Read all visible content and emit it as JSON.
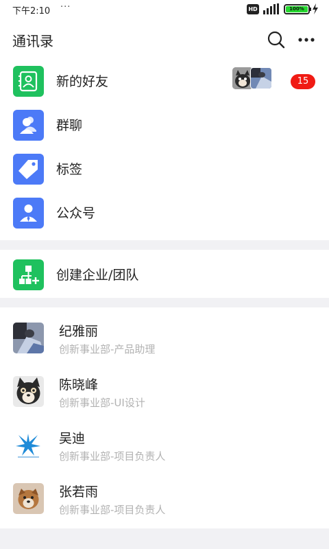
{
  "status_bar": {
    "time": "下午2:10",
    "dots": "···",
    "hd": "HD",
    "battery": "100%"
  },
  "header": {
    "title": "通讯录"
  },
  "menu": {
    "new_friends": {
      "label": "新的好友",
      "badge": "15"
    },
    "group_chat": {
      "label": "群聊"
    },
    "tags": {
      "label": "标签"
    },
    "official_accounts": {
      "label": "公众号"
    },
    "create_team": {
      "label": "创建企业/团队"
    }
  },
  "contacts": [
    {
      "name": "纪雅丽",
      "dept": "创新事业部-产品助理"
    },
    {
      "name": "陈晓峰",
      "dept": "创新事业部-UI设计"
    },
    {
      "name": "吴迪",
      "dept": "创新事业部-项目负责人"
    },
    {
      "name": "张若雨",
      "dept": "创新事业部-项目负责人"
    }
  ],
  "colors": {
    "green": "#1fc15e",
    "blue": "#4c7af7",
    "badge_red": "#f01b14",
    "gap_gray": "#f1f1f4"
  }
}
